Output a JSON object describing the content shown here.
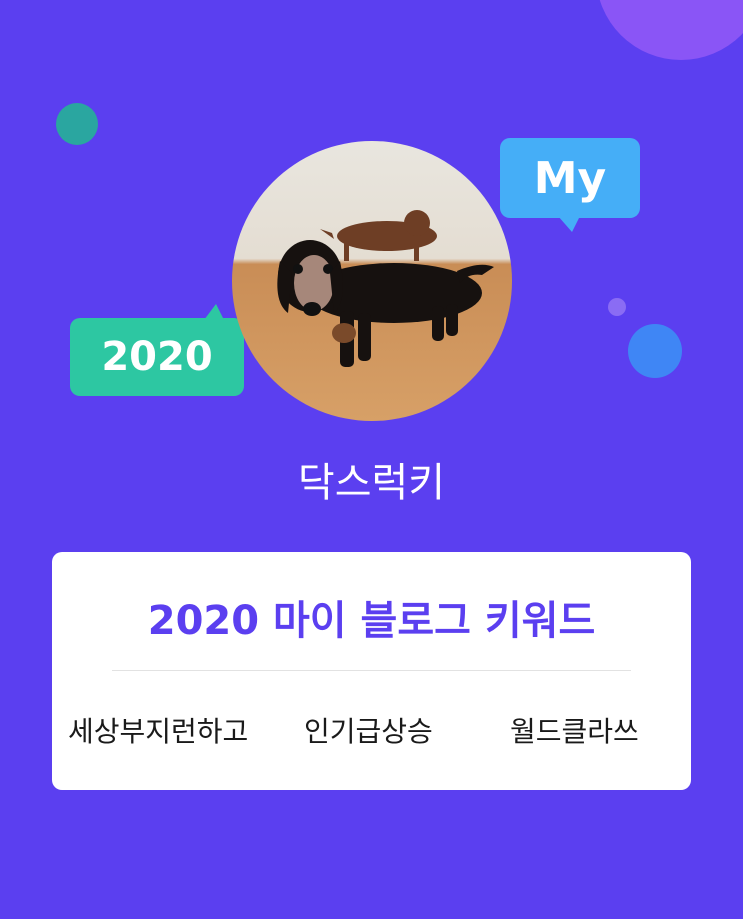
{
  "decorations": {
    "my_bubble": "My",
    "year_bubble": "2020"
  },
  "profile": {
    "nickname": "닥스럭키",
    "avatar_icon": "dachshund-photo"
  },
  "card": {
    "title": "2020 마이 블로그 키워드",
    "keywords": [
      "세상부지런하고",
      "인기급상승",
      "월드클라쓰"
    ]
  },
  "colors": {
    "background": "#5b3ff0",
    "my_bubble": "#45aef7",
    "year_bubble": "#2dc7a2",
    "title": "#5b3ff0"
  }
}
